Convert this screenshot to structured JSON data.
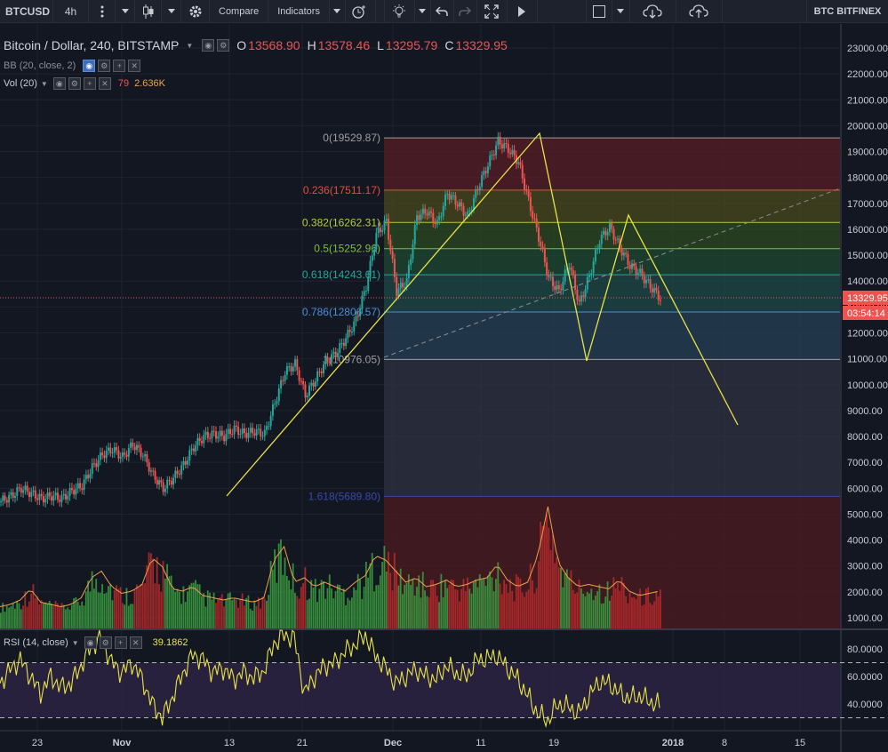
{
  "toolbar": {
    "symbol": "BTCUSD",
    "interval": "4h",
    "compare_label": "Compare",
    "indicators_label": "Indicators",
    "exchange_label": "BTC BITFINEX"
  },
  "legend": {
    "title": "Bitcoin / Dollar, 240, BITSTAMP",
    "open_key": "O",
    "open": "13568.90",
    "high_key": "H",
    "high": "13578.46",
    "low_key": "L",
    "low": "13295.79",
    "close_key": "C",
    "close": "13329.95",
    "bb": "BB (20, close, 2)",
    "vol_name": "Vol (20)",
    "vol_value1": "79",
    "vol_value2": "2.636K",
    "rsi_name": "RSI (14, close)",
    "rsi_value": "39.1862"
  },
  "colors": {
    "up": "#26a69a",
    "down": "#ef5350",
    "pattern": "#e8e24a",
    "rsi": "#e8e24a",
    "background": "#131722"
  },
  "price_labels": {
    "current": "13329.95",
    "countdown": "03:54:14"
  },
  "chart_data": {
    "type": "candlestick",
    "price_axis": {
      "range": [
        0,
        23000
      ],
      "ticks": [
        "23000.00",
        "22000.00",
        "21000.00",
        "20000.00",
        "19000.00",
        "18000.00",
        "17000.00",
        "16000.00",
        "15000.00",
        "14000.00",
        "13000.00",
        "12000.00",
        "11000.00",
        "10000.00",
        "9000.00",
        "8000.00",
        "7000.00",
        "6000.00",
        "5000.00",
        "4000.00",
        "3000.00",
        "2000.00",
        "1000.00"
      ]
    },
    "rsi_axis": {
      "ticks": [
        "80.0000",
        "60.0000",
        "40.0000"
      ],
      "levels": [
        70,
        30
      ]
    },
    "time_axis": {
      "labels": [
        "23",
        "Nov",
        "13",
        "21",
        "Dec",
        "11",
        "19",
        "2018",
        "8",
        "15"
      ]
    },
    "fibonacci": [
      {
        "label": "0(19529.87)",
        "level": 19529.87,
        "color": "#9e9e9e"
      },
      {
        "label": "0.236(17511.17)",
        "level": 17511.17,
        "color": "#e74c3c"
      },
      {
        "label": "0.382(16262.31)",
        "level": 16262.31,
        "color": "#b8cc3a"
      },
      {
        "label": "0.5(15252.96)",
        "level": 15252.96,
        "color": "#7fbf3f"
      },
      {
        "label": "0.618(14243.61)",
        "level": 14243.61,
        "color": "#26a69a"
      },
      {
        "label": "0.786(12806.57)",
        "level": 12806.57,
        "color": "#4a90d9"
      },
      {
        "label": "1(10976.05)",
        "level": 10976.05,
        "color": "#9e9e9e"
      },
      {
        "label": "1.618(5689.80)",
        "level": 5689.8,
        "color": "#3949ab"
      }
    ],
    "price_path": [
      [
        0,
        5500
      ],
      [
        5,
        5700
      ],
      [
        10,
        6000
      ],
      [
        15,
        5800
      ],
      [
        20,
        5600
      ],
      [
        25,
        5700
      ],
      [
        30,
        5600
      ],
      [
        35,
        5900
      ],
      [
        40,
        6100
      ],
      [
        45,
        6800
      ],
      [
        50,
        7300
      ],
      [
        55,
        7500
      ],
      [
        60,
        7200
      ],
      [
        65,
        7700
      ],
      [
        70,
        7300
      ],
      [
        75,
        6500
      ],
      [
        80,
        6000
      ],
      [
        85,
        6400
      ],
      [
        90,
        6900
      ],
      [
        95,
        7600
      ],
      [
        100,
        8000
      ],
      [
        105,
        8100
      ],
      [
        110,
        8000
      ],
      [
        115,
        8300
      ],
      [
        120,
        8100
      ],
      [
        125,
        8200
      ],
      [
        130,
        8100
      ],
      [
        135,
        9300
      ],
      [
        140,
        10500
      ],
      [
        145,
        10800
      ],
      [
        150,
        9600
      ],
      [
        155,
        10200
      ],
      [
        160,
        10900
      ],
      [
        165,
        11200
      ],
      [
        170,
        11800
      ],
      [
        175,
        12500
      ],
      [
        180,
        13800
      ],
      [
        185,
        15800
      ],
      [
        190,
        16300
      ],
      [
        195,
        13600
      ],
      [
        200,
        14000
      ],
      [
        205,
        16500
      ],
      [
        210,
        16700
      ],
      [
        215,
        16200
      ],
      [
        220,
        17400
      ],
      [
        225,
        17000
      ],
      [
        230,
        16500
      ],
      [
        235,
        17600
      ],
      [
        240,
        18500
      ],
      [
        245,
        19400
      ],
      [
        250,
        19100
      ],
      [
        255,
        18600
      ],
      [
        260,
        17100
      ],
      [
        265,
        15700
      ],
      [
        270,
        14100
      ],
      [
        275,
        13600
      ],
      [
        280,
        14700
      ],
      [
        285,
        13100
      ],
      [
        290,
        14200
      ],
      [
        295,
        15600
      ],
      [
        300,
        16100
      ],
      [
        305,
        15300
      ],
      [
        310,
        14600
      ],
      [
        315,
        14300
      ],
      [
        320,
        13800
      ],
      [
        325,
        13330
      ]
    ],
    "rsi_path": [
      [
        0,
        55
      ],
      [
        5,
        65
      ],
      [
        10,
        72
      ],
      [
        15,
        60
      ],
      [
        20,
        48
      ],
      [
        25,
        60
      ],
      [
        30,
        52
      ],
      [
        35,
        55
      ],
      [
        40,
        68
      ],
      [
        45,
        82
      ],
      [
        50,
        88
      ],
      [
        55,
        70
      ],
      [
        60,
        63
      ],
      [
        65,
        70
      ],
      [
        70,
        58
      ],
      [
        75,
        40
      ],
      [
        80,
        30
      ],
      [
        85,
        45
      ],
      [
        90,
        62
      ],
      [
        95,
        76
      ],
      [
        100,
        72
      ],
      [
        105,
        63
      ],
      [
        110,
        66
      ],
      [
        115,
        58
      ],
      [
        120,
        63
      ],
      [
        125,
        59
      ],
      [
        130,
        64
      ],
      [
        135,
        84
      ],
      [
        140,
        90
      ],
      [
        145,
        88
      ],
      [
        150,
        48
      ],
      [
        155,
        60
      ],
      [
        160,
        68
      ],
      [
        165,
        70
      ],
      [
        170,
        78
      ],
      [
        175,
        83
      ],
      [
        180,
        90
      ],
      [
        185,
        75
      ],
      [
        190,
        66
      ],
      [
        195,
        55
      ],
      [
        200,
        60
      ],
      [
        205,
        65
      ],
      [
        210,
        60
      ],
      [
        215,
        58
      ],
      [
        220,
        68
      ],
      [
        225,
        62
      ],
      [
        230,
        60
      ],
      [
        235,
        72
      ],
      [
        240,
        73
      ],
      [
        245,
        75
      ],
      [
        250,
        66
      ],
      [
        255,
        58
      ],
      [
        260,
        46
      ],
      [
        265,
        33
      ],
      [
        270,
        28
      ],
      [
        275,
        40
      ],
      [
        280,
        38
      ],
      [
        285,
        33
      ],
      [
        290,
        45
      ],
      [
        295,
        56
      ],
      [
        300,
        55
      ],
      [
        305,
        48
      ],
      [
        310,
        44
      ],
      [
        315,
        46
      ],
      [
        320,
        42
      ],
      [
        325,
        39
      ]
    ],
    "volume_path": [
      [
        0,
        500
      ],
      [
        5,
        600
      ],
      [
        10,
        800
      ],
      [
        15,
        1300
      ],
      [
        20,
        700
      ],
      [
        25,
        600
      ],
      [
        30,
        500
      ],
      [
        35,
        600
      ],
      [
        40,
        900
      ],
      [
        45,
        1800
      ],
      [
        50,
        2100
      ],
      [
        55,
        1400
      ],
      [
        60,
        1100
      ],
      [
        65,
        1200
      ],
      [
        70,
        1500
      ],
      [
        75,
        2700
      ],
      [
        80,
        2300
      ],
      [
        85,
        1300
      ],
      [
        90,
        1200
      ],
      [
        95,
        1400
      ],
      [
        100,
        1000
      ],
      [
        105,
        900
      ],
      [
        110,
        800
      ],
      [
        115,
        900
      ],
      [
        120,
        800
      ],
      [
        125,
        700
      ],
      [
        130,
        900
      ],
      [
        135,
        2600
      ],
      [
        140,
        3200
      ],
      [
        145,
        1600
      ],
      [
        150,
        1800
      ],
      [
        155,
        1400
      ],
      [
        160,
        1600
      ],
      [
        165,
        1400
      ],
      [
        170,
        1200
      ],
      [
        175,
        1600
      ],
      [
        180,
        1900
      ],
      [
        185,
        2800
      ],
      [
        190,
        2600
      ],
      [
        195,
        2100
      ],
      [
        200,
        1600
      ],
      [
        205,
        1800
      ],
      [
        210,
        1400
      ],
      [
        215,
        1500
      ],
      [
        220,
        1700
      ],
      [
        225,
        1400
      ],
      [
        230,
        1500
      ],
      [
        235,
        1700
      ],
      [
        240,
        1800
      ],
      [
        245,
        2400
      ],
      [
        250,
        1700
      ],
      [
        255,
        1400
      ],
      [
        260,
        1600
      ],
      [
        265,
        2800
      ],
      [
        270,
        5000
      ],
      [
        275,
        2500
      ],
      [
        280,
        1800
      ],
      [
        285,
        1400
      ],
      [
        290,
        1500
      ],
      [
        295,
        1400
      ],
      [
        300,
        1300
      ],
      [
        305,
        1700
      ],
      [
        310,
        1200
      ],
      [
        315,
        1000
      ],
      [
        320,
        1100
      ],
      [
        325,
        1200
      ]
    ]
  }
}
